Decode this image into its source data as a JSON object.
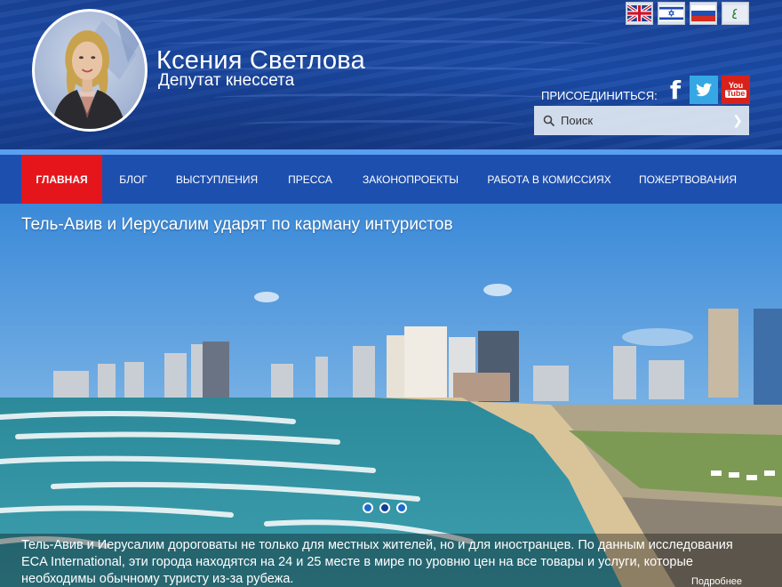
{
  "header": {
    "name": "Ксения Светлова",
    "subtitle": "Депутат кнессета",
    "join_label": "ПРИСОЕДИНИТЬСЯ:",
    "languages": [
      "english-flag-icon",
      "hebrew-israel-flag-icon",
      "russian-flag-icon",
      "arabic-language-icon"
    ],
    "social": {
      "youtube_line1": "You",
      "youtube_line2": "Tube"
    }
  },
  "search": {
    "placeholder": "Поиск"
  },
  "nav": {
    "items": [
      {
        "label": "ГЛАВНАЯ",
        "active": true
      },
      {
        "label": "БЛОГ"
      },
      {
        "label": "ВЫСТУПЛЕНИЯ"
      },
      {
        "label": "ПРЕССА"
      },
      {
        "label": "ЗАКОНОПРОЕКТЫ"
      },
      {
        "label": "РАБОТА В КОМИССИЯХ"
      },
      {
        "label": "ПОЖЕРТВОВАНИЯ"
      }
    ]
  },
  "slider": {
    "headline": "Тель-Авив и Иерусалим ударят по карману интуристов",
    "caption": "Тель-Авив и Иерусалим дороговаты не только для местных жителей, но и для иностранцев. По данным исследования ECA International, эти города находятся на 24 и 25 месте в мире по уровню цен на все товары и услуги, которые необходимы обычному туристу из-за рубежа.",
    "more_label": "Подробнее",
    "slide_count": 3,
    "active_slide": 2
  },
  "colors": {
    "header_blue": "#1f55b8",
    "nav_blue": "#1d4faf",
    "active_red": "#e4161c",
    "twitter": "#35a7e5",
    "youtube": "#d9211c"
  }
}
